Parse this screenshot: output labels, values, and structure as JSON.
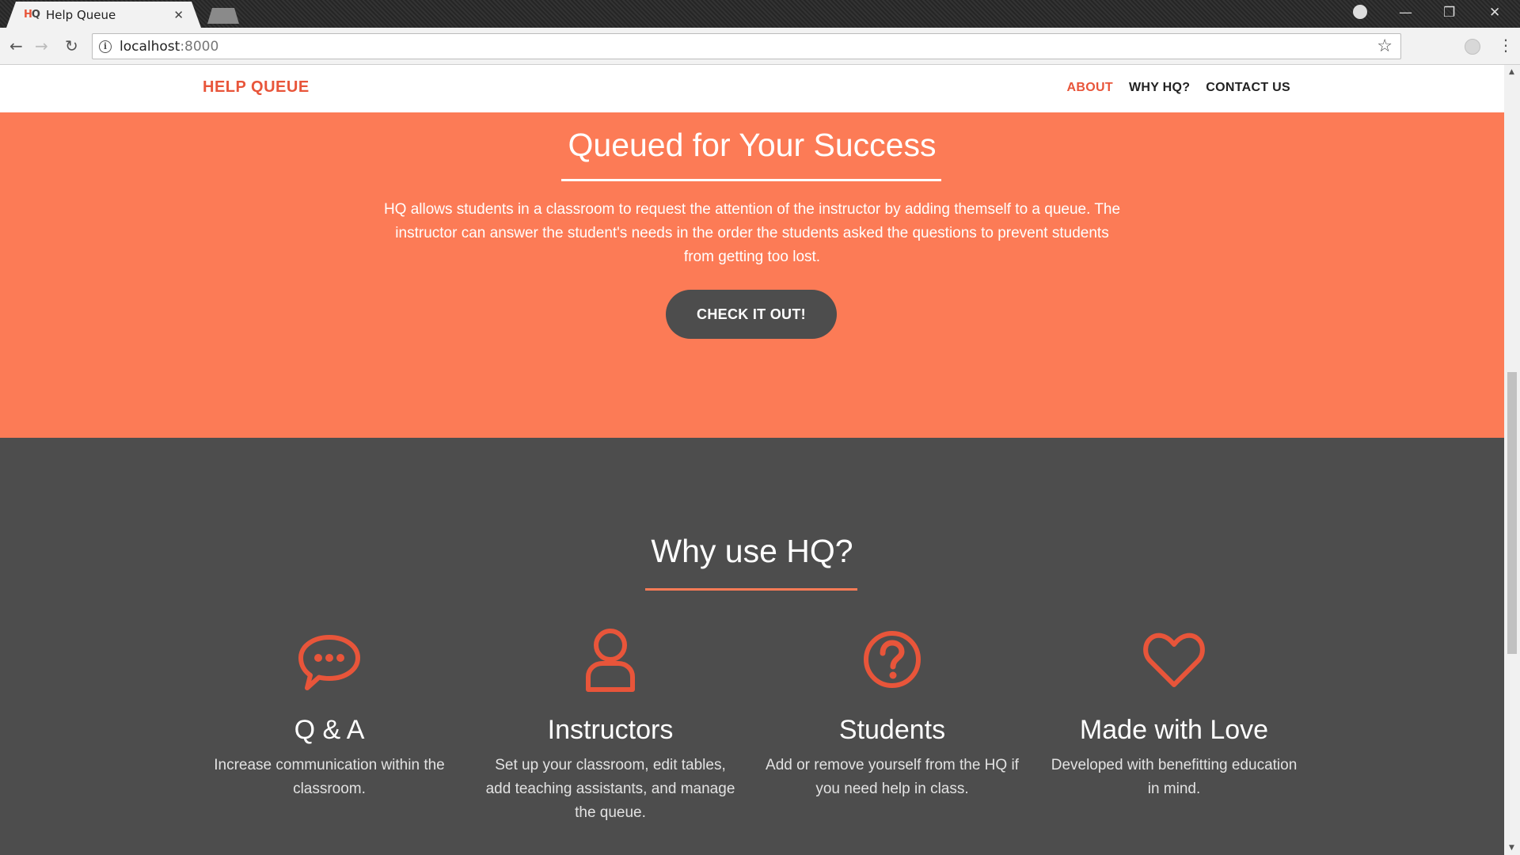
{
  "browser": {
    "tab_title": "Help Queue",
    "favicon_text": "HQ",
    "url_host": "localhost",
    "url_port": ":8000"
  },
  "site": {
    "brand": "HELP QUEUE",
    "nav": [
      {
        "label": "ABOUT",
        "active": true
      },
      {
        "label": "WHY HQ?",
        "active": false
      },
      {
        "label": "CONTACT US",
        "active": false
      }
    ]
  },
  "hero": {
    "title": "Queued for Your Success",
    "text": "HQ allows students in a classroom to request the attention of the instructor by adding themself to a queue. The instructor can answer the student's needs in the order the students asked the questions to prevent students from getting too lost.",
    "cta_label": "CHECK IT OUT!"
  },
  "features": {
    "title": "Why use HQ?",
    "items": [
      {
        "icon": "speech-bubble-icon",
        "title": "Q & A",
        "desc": "Increase communication within the classroom."
      },
      {
        "icon": "user-icon",
        "title": "Instructors",
        "desc": "Set up your classroom, edit tables, add teaching assistants, and manage the queue."
      },
      {
        "icon": "question-icon",
        "title": "Students",
        "desc": "Add or remove yourself from the HQ if you need help in class."
      },
      {
        "icon": "heart-icon",
        "title": "Made with Love",
        "desc": "Developed with benefitting education in mind."
      }
    ]
  },
  "colors": {
    "accent": "#fc7b56",
    "brand": "#e8553a",
    "dark": "#4d4d4d"
  }
}
